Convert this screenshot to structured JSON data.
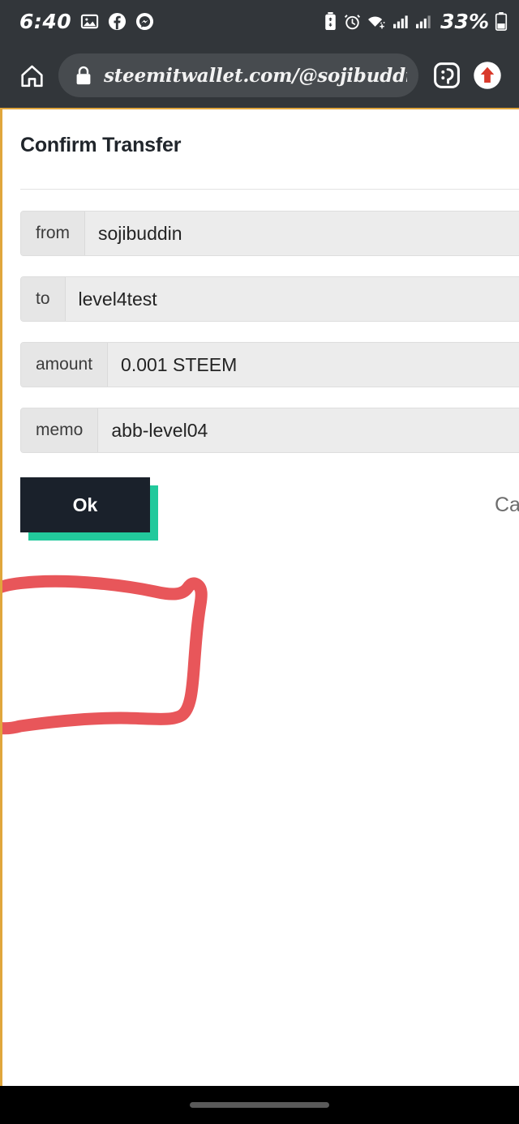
{
  "status_bar": {
    "time": "6:40",
    "battery_percent": "33%",
    "left_icons": [
      "photos-icon",
      "facebook-icon",
      "messenger-icon"
    ],
    "right_icons": [
      "battery-saver-icon",
      "alarm-icon",
      "wifi-icon",
      "signal-sim1-icon",
      "signal-sim2-icon",
      "battery-icon"
    ],
    "colors": {
      "background": "#32363a",
      "foreground": "#ffffff"
    }
  },
  "browser": {
    "home_icon": "home-icon",
    "lock_icon": "lock-icon",
    "url": "steemitwallet.com/@sojibuddi",
    "tabs_icon": "smiley-tab-icon",
    "tabs_label": ":D",
    "menu_icon": "upload-arrow-icon",
    "colors": {
      "chrome": "#32363a",
      "omnibox": "#474b4f",
      "accent": "#d93a2b"
    }
  },
  "page": {
    "title": "Confirm Transfer",
    "border_color": "#e0a63c",
    "fields": [
      {
        "label": "from",
        "value": "sojibuddin"
      },
      {
        "label": "to",
        "value": "level4test"
      },
      {
        "label": "amount",
        "value": "0.001 STEEM"
      },
      {
        "label": "memo",
        "value": "abb-level04"
      }
    ],
    "buttons": {
      "ok_label": "Ok",
      "cancel_label": "Cancel",
      "ok_bg": "#1a212b",
      "ok_shadow": "#22c99c",
      "cancel_color": "#6d6d6d"
    }
  },
  "annotation": {
    "type": "hand-drawn-rectangle",
    "target": "ok-button",
    "color": "#e8565a",
    "stroke_width": 15
  },
  "nav_bar": {
    "gesture_pill": "gesture-pill",
    "background": "#000000"
  }
}
